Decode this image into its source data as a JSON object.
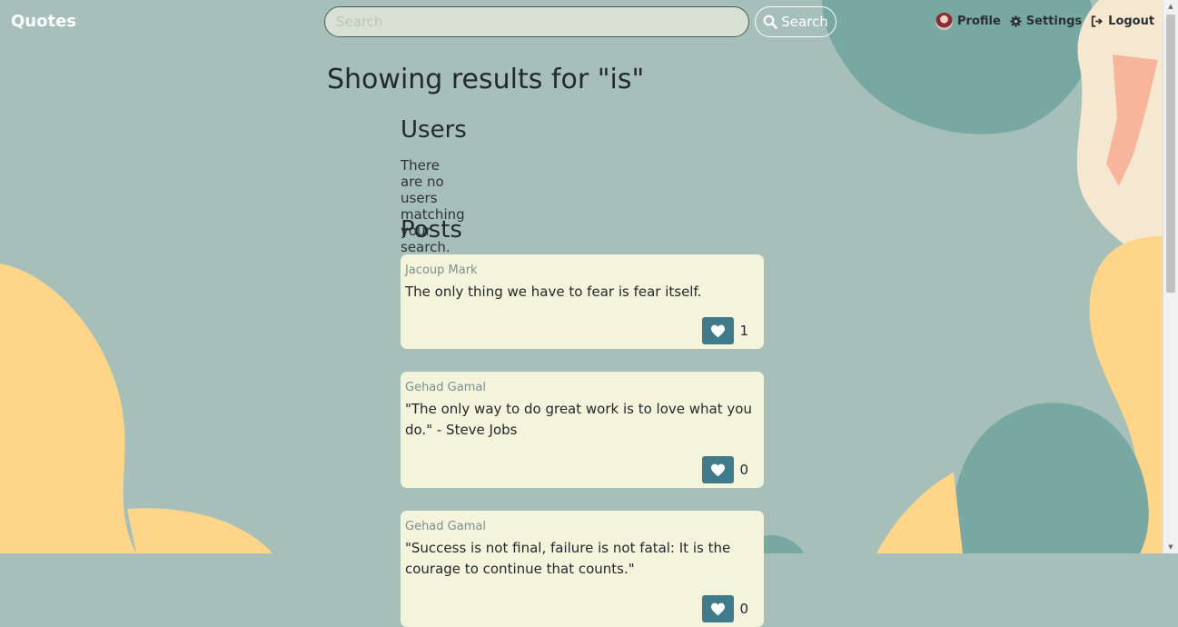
{
  "navbar": {
    "brand": "Quotes",
    "search_placeholder": "Search",
    "search_value": "",
    "search_button": "Search",
    "links": {
      "profile": "Profile",
      "settings": "Settings",
      "logout": "Logout"
    }
  },
  "main": {
    "title": "Showing results for \"is\"",
    "users": {
      "heading": "Users",
      "empty_message": "There are no users matching your search."
    },
    "posts": {
      "heading": "Posts",
      "items": [
        {
          "author": "Jacoup Mark",
          "text": "The only thing we have to fear is fear itself.",
          "likes": "1"
        },
        {
          "author": "Gehad Gamal",
          "text": "\"The only way to do great work is to love what you do.\" - Steve Jobs",
          "likes": "0"
        },
        {
          "author": "Gehad Gamal",
          "text": "\"Success is not final, failure is not fatal: It is the courage to continue that counts.\"",
          "likes": "0"
        }
      ]
    }
  },
  "icons": {
    "search": "search-icon",
    "avatar": "avatar",
    "settings": "gear-icon",
    "logout": "logout-icon",
    "like": "heart-icon"
  },
  "colors": {
    "background": "#a6bfb9",
    "blob_teal": "#79a8a2",
    "blob_yellow": "#fed589",
    "blob_cream": "#f6e8d0",
    "card": "#f4f3dc",
    "like_button": "#3f7b8a",
    "author_text": "#7b9190"
  }
}
